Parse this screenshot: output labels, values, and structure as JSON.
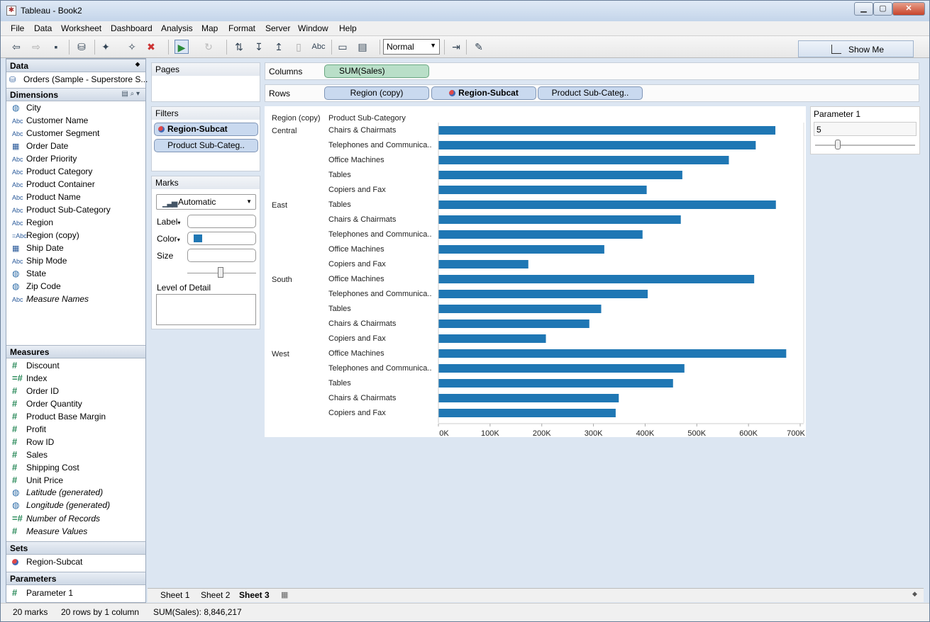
{
  "window": {
    "title": "Tableau - Book2"
  },
  "menu": [
    "File",
    "Data",
    "Worksheet",
    "Dashboard",
    "Analysis",
    "Map",
    "Format",
    "Server",
    "Window",
    "Help"
  ],
  "toolbar": {
    "fit": "Normal",
    "label_button": "Abc",
    "show_me": "Show Me"
  },
  "data_pane": {
    "header": "Data",
    "source": "Orders (Sample - Superstore S...",
    "dimensions_header": "Dimensions",
    "dimensions": [
      {
        "icon": "globe",
        "label": "City",
        "italic": false
      },
      {
        "icon": "abc",
        "label": "Customer Name",
        "italic": false
      },
      {
        "icon": "abc",
        "label": "Customer Segment",
        "italic": false
      },
      {
        "icon": "cal",
        "label": "Order Date",
        "italic": false
      },
      {
        "icon": "abc",
        "label": "Order Priority",
        "italic": false
      },
      {
        "icon": "abc",
        "label": "Product Category",
        "italic": false
      },
      {
        "icon": "abc",
        "label": "Product Container",
        "italic": false
      },
      {
        "icon": "abc",
        "label": "Product Name",
        "italic": false
      },
      {
        "icon": "abc",
        "label": "Product Sub-Category",
        "italic": false
      },
      {
        "icon": "abc",
        "label": "Region",
        "italic": false
      },
      {
        "icon": "abc-calc",
        "label": "Region (copy)",
        "italic": false
      },
      {
        "icon": "cal",
        "label": "Ship Date",
        "italic": false
      },
      {
        "icon": "abc",
        "label": "Ship Mode",
        "italic": false
      },
      {
        "icon": "globe",
        "label": "State",
        "italic": false
      },
      {
        "icon": "globe",
        "label": "Zip Code",
        "italic": false
      },
      {
        "icon": "abc",
        "label": "Measure Names",
        "italic": true
      }
    ],
    "measures_header": "Measures",
    "measures": [
      {
        "icon": "hash",
        "label": "Discount",
        "italic": false
      },
      {
        "icon": "hash-calc",
        "label": "Index",
        "italic": false
      },
      {
        "icon": "hash",
        "label": "Order ID",
        "italic": false
      },
      {
        "icon": "hash",
        "label": "Order Quantity",
        "italic": false
      },
      {
        "icon": "hash",
        "label": "Product Base Margin",
        "italic": false
      },
      {
        "icon": "hash",
        "label": "Profit",
        "italic": false
      },
      {
        "icon": "hash",
        "label": "Row ID",
        "italic": false
      },
      {
        "icon": "hash",
        "label": "Sales",
        "italic": false
      },
      {
        "icon": "hash",
        "label": "Shipping Cost",
        "italic": false
      },
      {
        "icon": "hash",
        "label": "Unit Price",
        "italic": false
      },
      {
        "icon": "globe",
        "label": "Latitude (generated)",
        "italic": true
      },
      {
        "icon": "globe",
        "label": "Longitude (generated)",
        "italic": true
      },
      {
        "icon": "hash-calc",
        "label": "Number of Records",
        "italic": true
      },
      {
        "icon": "hash",
        "label": "Measure Values",
        "italic": true
      }
    ],
    "sets_header": "Sets",
    "sets": [
      "Region-Subcat"
    ],
    "parameters_header": "Parameters",
    "parameters": [
      "Parameter 1"
    ]
  },
  "shelves": {
    "pages": "Pages",
    "filters": "Filters",
    "filter_pills": [
      "Region-Subcat",
      "Product Sub-Categ.."
    ],
    "marks": "Marks",
    "mark_type": "Automatic",
    "label": "Label",
    "color": "Color",
    "size": "Size",
    "level_of_detail": "Level of Detail",
    "columns": "Columns",
    "column_pills": [
      "SUM(Sales)"
    ],
    "rows": "Rows",
    "row_pills": [
      "Region (copy)",
      "Region-Subcat",
      "Product Sub-Categ.."
    ]
  },
  "parameter_card": {
    "title": "Parameter 1",
    "value": "5"
  },
  "sheet_tabs": [
    "Sheet 1",
    "Sheet 2",
    "Sheet 3"
  ],
  "status": {
    "marks": "20 marks",
    "rows": "20 rows by 1 column",
    "sum": "SUM(Sales): 8,846,217"
  },
  "colors": {
    "bar": "#1f77b4"
  },
  "chart_data": {
    "type": "bar",
    "orientation": "horizontal",
    "row_headers": [
      "Region (copy)",
      "Product Sub-Category"
    ],
    "groups": [
      {
        "region": "Central",
        "rows": [
          {
            "category": "Chairs & Chairmats",
            "value": 652000
          },
          {
            "category": "Telephones and Communica..",
            "value": 614000
          },
          {
            "category": "Office Machines",
            "value": 562000
          },
          {
            "category": "Tables",
            "value": 472000
          },
          {
            "category": "Copiers and Fax",
            "value": 403000
          }
        ]
      },
      {
        "region": "East",
        "rows": [
          {
            "category": "Tables",
            "value": 653000
          },
          {
            "category": "Chairs & Chairmats",
            "value": 469000
          },
          {
            "category": "Telephones and Communica..",
            "value": 395000
          },
          {
            "category": "Office Machines",
            "value": 321000
          },
          {
            "category": "Copiers and Fax",
            "value": 174000
          }
        ]
      },
      {
        "region": "South",
        "rows": [
          {
            "category": "Office Machines",
            "value": 611000
          },
          {
            "category": "Telephones and Communica..",
            "value": 405000
          },
          {
            "category": "Tables",
            "value": 315000
          },
          {
            "category": "Chairs & Chairmats",
            "value": 292000
          },
          {
            "category": "Copiers and Fax",
            "value": 208000
          }
        ]
      },
      {
        "region": "West",
        "rows": [
          {
            "category": "Office Machines",
            "value": 673000
          },
          {
            "category": "Telephones and Communica..",
            "value": 476000
          },
          {
            "category": "Tables",
            "value": 454000
          },
          {
            "category": "Chairs & Chairmats",
            "value": 349000
          },
          {
            "category": "Copiers and Fax",
            "value": 343000
          }
        ]
      }
    ],
    "xlim": [
      0,
      700000
    ],
    "xticks": [
      "0K",
      "100K",
      "200K",
      "300K",
      "400K",
      "500K",
      "600K",
      "700K"
    ],
    "grid": false
  }
}
